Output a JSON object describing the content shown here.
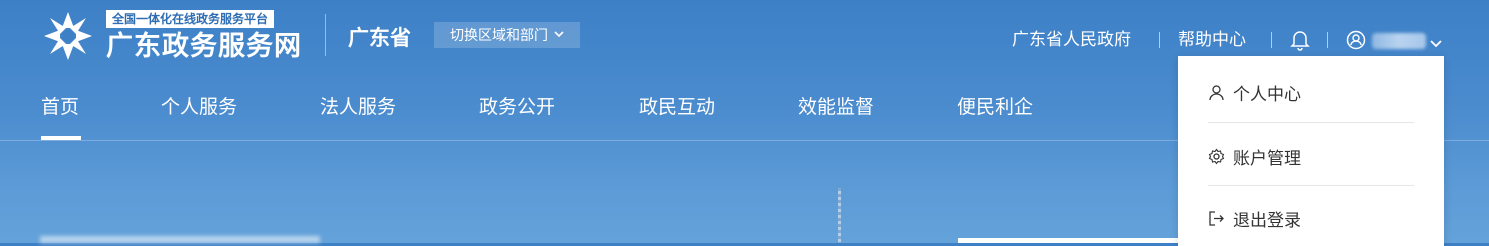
{
  "logo": {
    "subtitle": "全国一体化在线政务服务平台",
    "title": "广东政务服务网"
  },
  "region": {
    "province": "广东省",
    "switch_label": "切换区域和部门"
  },
  "top_links": {
    "gov": "广东省人民政府",
    "help": "帮助中心"
  },
  "nav": {
    "items": [
      "首页",
      "个人服务",
      "法人服务",
      "政务公开",
      "政民互动",
      "效能监督",
      "便民利企"
    ],
    "active_index": 0
  },
  "user_menu": {
    "items": [
      {
        "label": "个人中心",
        "icon": "user-icon"
      },
      {
        "label": "账户管理",
        "icon": "gear-icon"
      },
      {
        "label": "退出登录",
        "icon": "logout-icon"
      }
    ]
  },
  "colors": {
    "header_bg": "#3d80c6",
    "accent": "#2e6db3"
  }
}
